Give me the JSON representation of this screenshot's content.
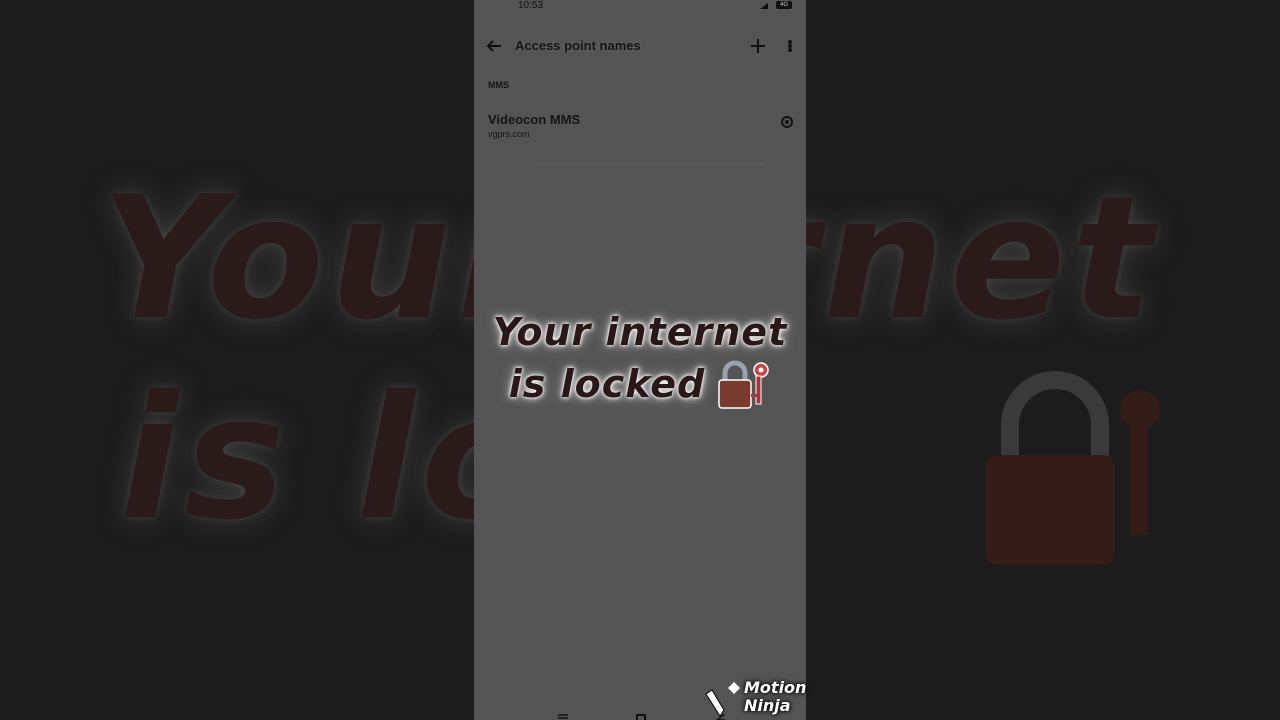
{
  "status_bar": {
    "time": "10:53",
    "battery": "4G"
  },
  "app_bar": {
    "title": "Access point names",
    "back_icon": "arrow-left-icon",
    "add_icon": "plus-icon",
    "more_icon": "more-vert-icon"
  },
  "section": {
    "header": "MMS"
  },
  "apn_list": [
    {
      "name": "Videocon MMS",
      "apn": "vgprs.com",
      "selected": true
    }
  ],
  "overlay": {
    "line1": "Your internet",
    "line2": "is locked",
    "icon": "lock-with-key-icon"
  },
  "background": {
    "line1": "Your   ernet",
    "line2": "is lo      d"
  },
  "watermark": {
    "line1": "Motion",
    "line2": "Ninja",
    "icon": "motion-ninja-logo-icon"
  },
  "colors": {
    "overlay_text": "#2a1717",
    "lock_body": "#7a3a2e",
    "screen_bg": "#545454"
  }
}
